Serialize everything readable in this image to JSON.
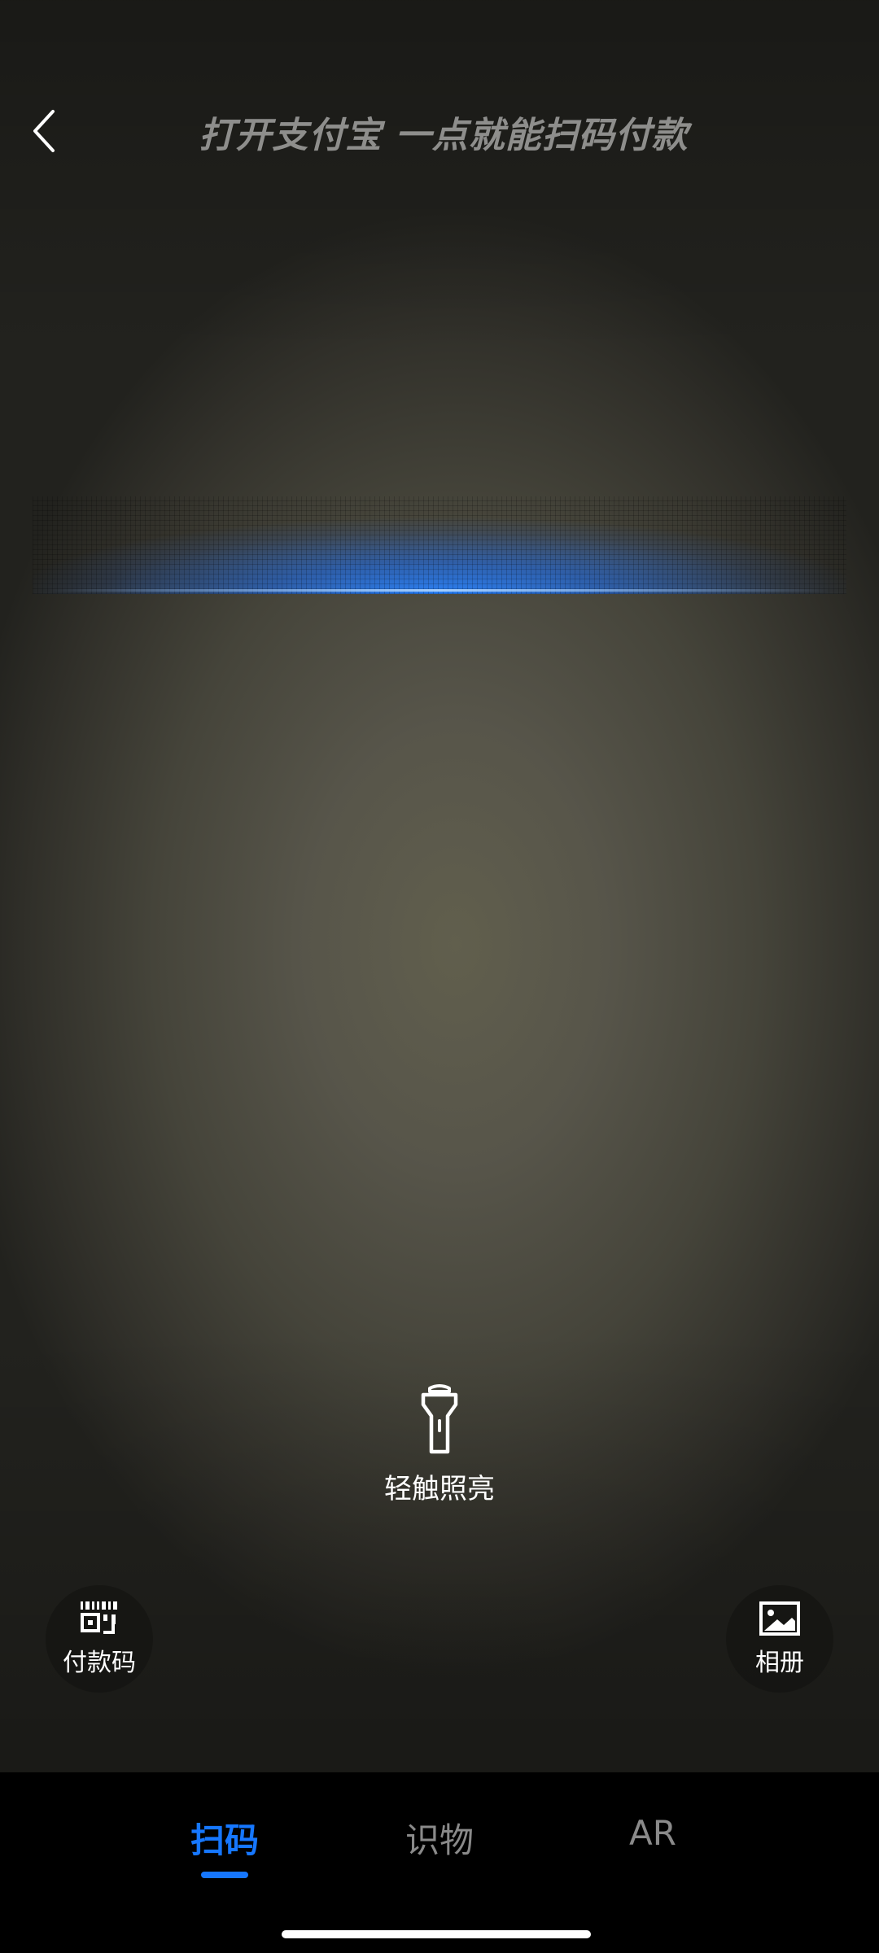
{
  "header": {
    "back_icon": "chevron-left-icon",
    "headline": "打开支付宝 一点就能扫码付款"
  },
  "scanner": {
    "accent_color": "#1677ff",
    "torch_icon": "flashlight-icon",
    "torch_label": "轻触照亮"
  },
  "actions": {
    "pay_code": {
      "icon": "barcode-qr-icon",
      "label": "付款码"
    },
    "album": {
      "icon": "image-icon",
      "label": "相册"
    }
  },
  "tabs": [
    {
      "label": "扫码",
      "active": true
    },
    {
      "label": "识物",
      "active": false
    },
    {
      "label": "AR",
      "active": false
    }
  ],
  "colors": {
    "active_tab": "#1677ff",
    "inactive_tab": "#8a8a8a"
  }
}
